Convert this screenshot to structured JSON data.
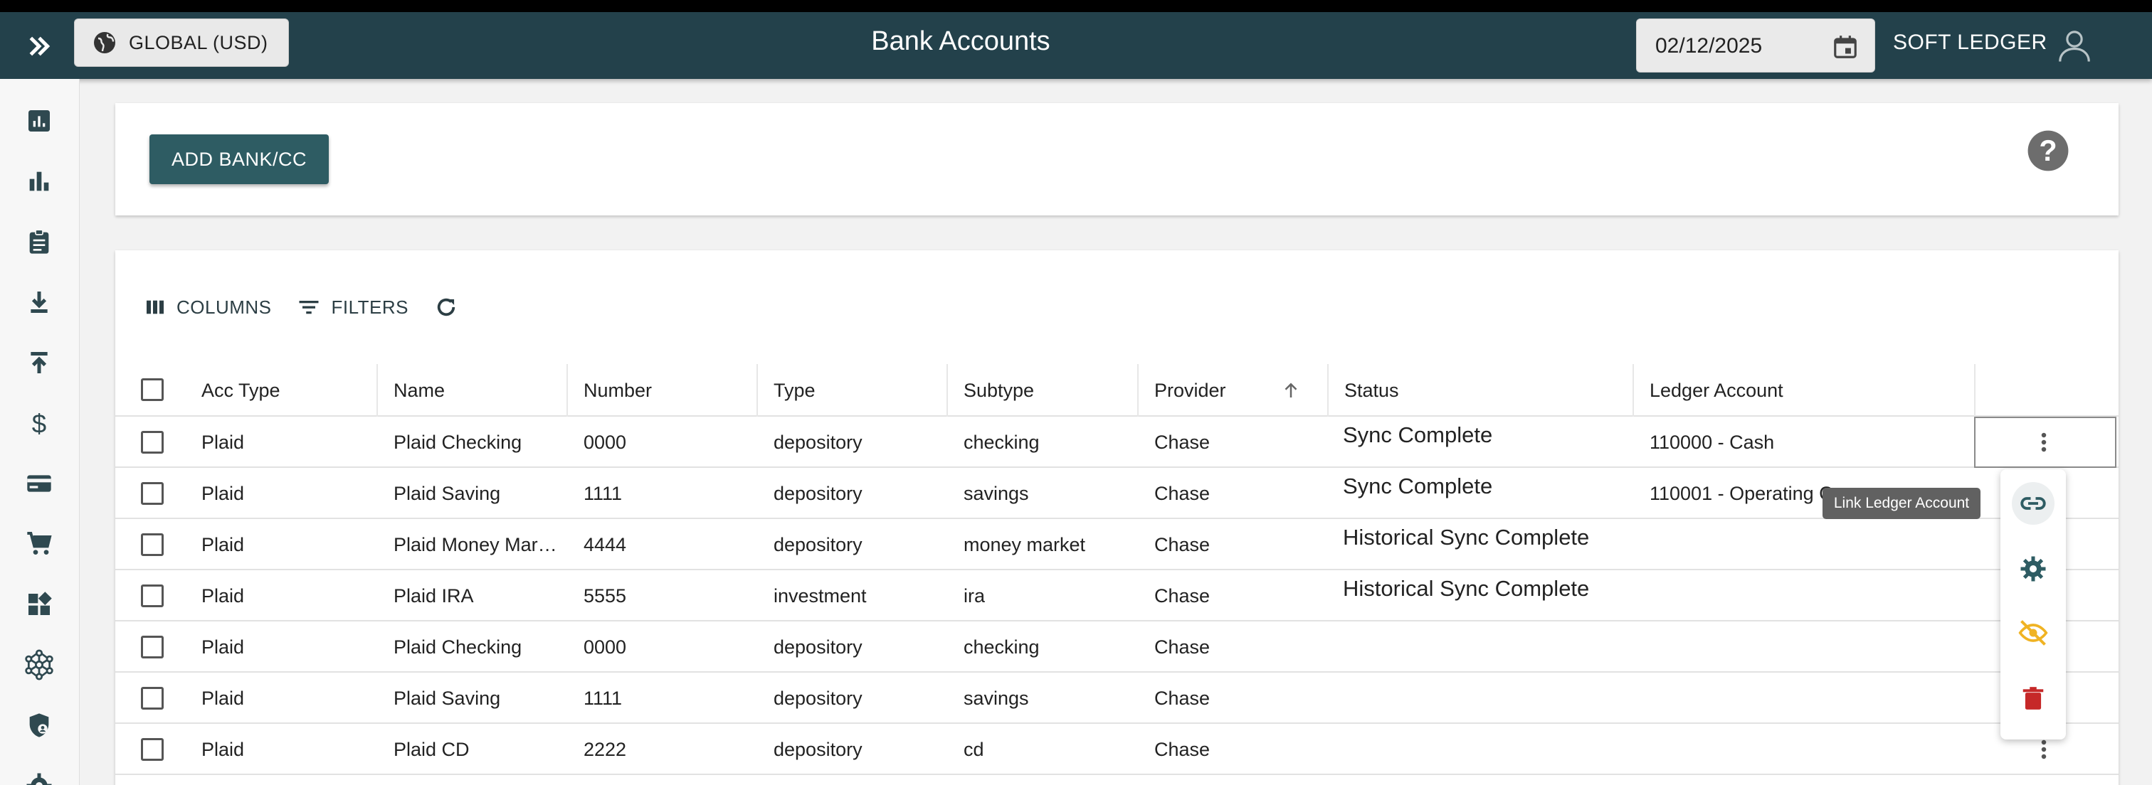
{
  "app": {
    "title": "Bank Accounts",
    "scope_label": "GLOBAL (USD)",
    "date_value": "02/12/2025",
    "company": "SOFT LEDGER"
  },
  "sidebar": {
    "items": [
      {
        "icon": "report-icon"
      },
      {
        "icon": "bar-chart-icon"
      },
      {
        "icon": "clipboard-icon"
      },
      {
        "icon": "download-icon"
      },
      {
        "icon": "upload-icon"
      },
      {
        "icon": "dollar-icon"
      },
      {
        "icon": "credit-card-icon"
      },
      {
        "icon": "cart-icon"
      },
      {
        "icon": "dashboard-icon"
      },
      {
        "icon": "network-icon"
      },
      {
        "icon": "security-icon"
      },
      {
        "icon": "gear-icon"
      }
    ]
  },
  "actions": {
    "add_label": "ADD BANK/CC"
  },
  "toolbar": {
    "columns_label": "COLUMNS",
    "filters_label": "FILTERS"
  },
  "table": {
    "columns": [
      "Acc Type",
      "Name",
      "Number",
      "Type",
      "Subtype",
      "Provider",
      "Status",
      "Ledger Account"
    ],
    "sort": {
      "column": "Provider",
      "direction": "ascending"
    },
    "rows": [
      {
        "acc_type": "Plaid",
        "name": "Plaid Checking",
        "number": "0000",
        "type": "depository",
        "subtype": "checking",
        "provider": "Chase",
        "status": "Sync Complete",
        "ledger": "110000 - Cash"
      },
      {
        "acc_type": "Plaid",
        "name": "Plaid Saving",
        "number": "1111",
        "type": "depository",
        "subtype": "savings",
        "provider": "Chase",
        "status": "Sync Complete",
        "ledger": "110001 - Operating C"
      },
      {
        "acc_type": "Plaid",
        "name": "Plaid Money Mar…",
        "number": "4444",
        "type": "depository",
        "subtype": "money market",
        "provider": "Chase",
        "status": "Historical Sync Complete",
        "ledger": ""
      },
      {
        "acc_type": "Plaid",
        "name": "Plaid IRA",
        "number": "5555",
        "type": "investment",
        "subtype": "ira",
        "provider": "Chase",
        "status": "Historical Sync Complete",
        "ledger": ""
      },
      {
        "acc_type": "Plaid",
        "name": "Plaid Checking",
        "number": "0000",
        "type": "depository",
        "subtype": "checking",
        "provider": "Chase",
        "status": "",
        "ledger": ""
      },
      {
        "acc_type": "Plaid",
        "name": "Plaid Saving",
        "number": "1111",
        "type": "depository",
        "subtype": "savings",
        "provider": "Chase",
        "status": "",
        "ledger": ""
      },
      {
        "acc_type": "Plaid",
        "name": "Plaid CD",
        "number": "2222",
        "type": "depository",
        "subtype": "cd",
        "provider": "Chase",
        "status": "",
        "ledger": ""
      }
    ]
  },
  "row_menu": {
    "tooltip": "Link Ledger Account",
    "items": [
      {
        "icon": "link-icon",
        "color": "#2e5c63"
      },
      {
        "icon": "gear-icon",
        "color": "#2e5c63"
      },
      {
        "icon": "eye-off-icon",
        "color": "#f0b323"
      },
      {
        "icon": "trash-icon",
        "color": "#c62828"
      }
    ]
  },
  "colors": {
    "appbar": "#23414b",
    "primary": "#2e5c63",
    "warning": "#f0b323",
    "danger": "#c62828"
  }
}
